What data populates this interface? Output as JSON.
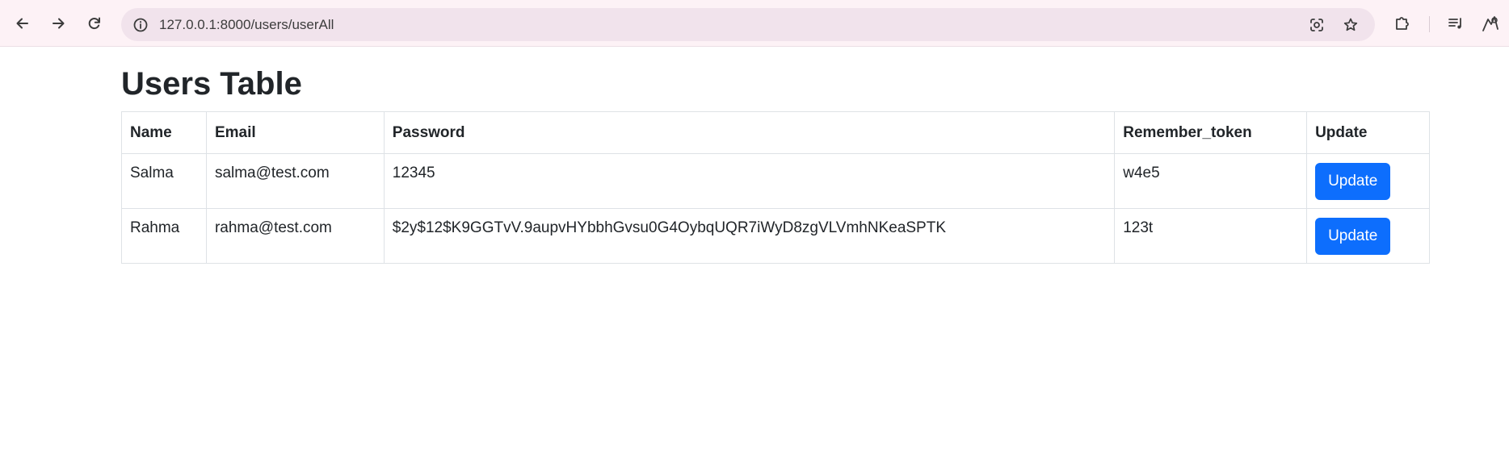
{
  "browser": {
    "url": "127.0.0.1:8000/users/userAll",
    "icons": {
      "back": "back-arrow-icon",
      "forward": "forward-arrow-icon",
      "reload": "reload-icon",
      "site_info": "site-info-icon",
      "lens": "google-lens-icon",
      "bookmark": "bookmark-star-icon",
      "extensions": "extensions-puzzle-icon",
      "media": "media-control-icon",
      "profile": "profile-avatar-icon"
    }
  },
  "page": {
    "title": "Users Table",
    "table": {
      "headers": [
        "Name",
        "Email",
        "Password",
        "Remember_token",
        "Update"
      ],
      "rows": [
        {
          "name": "Salma",
          "email": "salma@test.com",
          "password": "12345",
          "remember_token": "w4e5",
          "action_label": "Update"
        },
        {
          "name": "Rahma",
          "email": "rahma@test.com",
          "password": "$2y$12$K9GGTvV.9aupvHYbbhGvsu0G4OybqUQR7iWyD8zgVLVmhNKeaSPTK",
          "remember_token": "123t",
          "action_label": "Update"
        }
      ]
    }
  },
  "colors": {
    "primary_button": "#0d6efd",
    "chrome_background": "#fdf2f6",
    "omnibox_background": "#f1e3ec",
    "table_border": "#dee2e6"
  }
}
